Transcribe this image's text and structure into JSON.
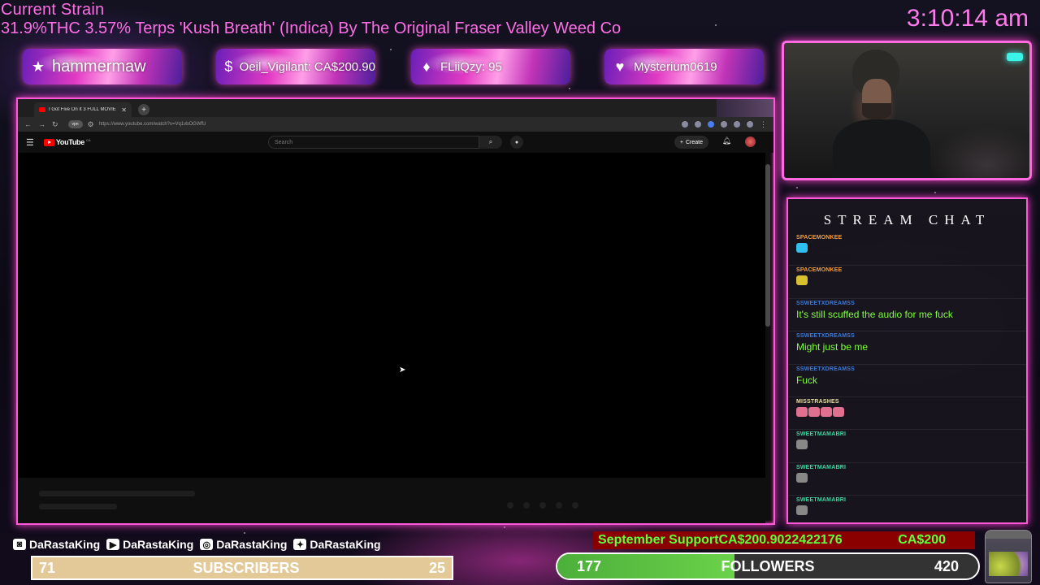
{
  "overlay": {
    "strain_title": "Current Strain",
    "strain_desc": "31.9%THC 3.57% Terps 'Kush Breath' (Indica) By The Original Fraser Valley Weed Co",
    "clock": "3:10:14 am"
  },
  "badges": [
    {
      "icon": "star-icon",
      "glyph": "★",
      "text": "hammermaw"
    },
    {
      "icon": "dollar-icon",
      "glyph": "$",
      "text": "Oeil_Vigilant: CA$200.90"
    },
    {
      "icon": "diamond-icon",
      "glyph": "♦",
      "text": "FLiiQzy: 95"
    },
    {
      "icon": "heart-icon",
      "glyph": "♥",
      "text": "Mysterium0619"
    }
  ],
  "browser": {
    "tab_title": "I Got Five On It 3 FULL MOVIE",
    "url": "https://www.youtube.com/watch?v=Vq1vbOGWfU",
    "site_name": "YouTube",
    "country_code": "CA",
    "search_placeholder": "Search",
    "create_label": "Create"
  },
  "chat": {
    "title": "STREAM CHAT",
    "messages": [
      {
        "user": "SPACEMONKEE",
        "user_color": "#f0a040",
        "text": "",
        "emotes": [
          "#30c0f0"
        ]
      },
      {
        "user": "SPACEMONKEE",
        "user_color": "#f0a040",
        "text": "",
        "emotes": [
          "#d8c030"
        ]
      },
      {
        "user": "SSWEETXDREAMSS",
        "user_color": "#3a7ad8",
        "text": "It's still scuffed the audio for me fuck",
        "emotes": []
      },
      {
        "user": "SSWEETXDREAMSS",
        "user_color": "#3a7ad8",
        "text": "Might just be me",
        "emotes": []
      },
      {
        "user": "SSWEETXDREAMSS",
        "user_color": "#3a7ad8",
        "text": "Fuck",
        "emotes": []
      },
      {
        "user": "MISSTRASHES",
        "user_color": "#e8e0a0",
        "text": "",
        "emotes": [
          "#e07090",
          "#e07090",
          "#e07090",
          "#e07090"
        ]
      },
      {
        "user": "SWEETMAMABRI",
        "user_color": "#3ad8a0",
        "text": "",
        "emotes": [
          "#888888"
        ]
      },
      {
        "user": "SWEETMAMABRI",
        "user_color": "#3ad8a0",
        "text": "",
        "emotes": [
          "#888888"
        ]
      },
      {
        "user": "SWEETMAMABRI",
        "user_color": "#3ad8a0",
        "text": "",
        "emotes": [
          "#888888"
        ]
      }
    ]
  },
  "socials": [
    {
      "icon": "twitch-icon",
      "glyph": "◙",
      "handle": "DaRastaKing"
    },
    {
      "icon": "youtube-icon",
      "glyph": "▶",
      "handle": "DaRastaKing"
    },
    {
      "icon": "instagram-icon",
      "glyph": "◎",
      "handle": "DaRastaKing"
    },
    {
      "icon": "twitter-icon",
      "glyph": "✦",
      "handle": "DaRastaKing"
    }
  ],
  "subscribers": {
    "current": "71",
    "label": "SUBSCRIBERS",
    "goal": "25"
  },
  "support": {
    "label": "September Support",
    "amount": "CA$200.9022422176",
    "goal": "CA$200"
  },
  "followers": {
    "current": "177",
    "label": "FOLLOWERS",
    "goal": "420",
    "progress": 0.42
  },
  "colors": {
    "accent": "#ff58d8",
    "chat_text": "#7dff3a"
  }
}
